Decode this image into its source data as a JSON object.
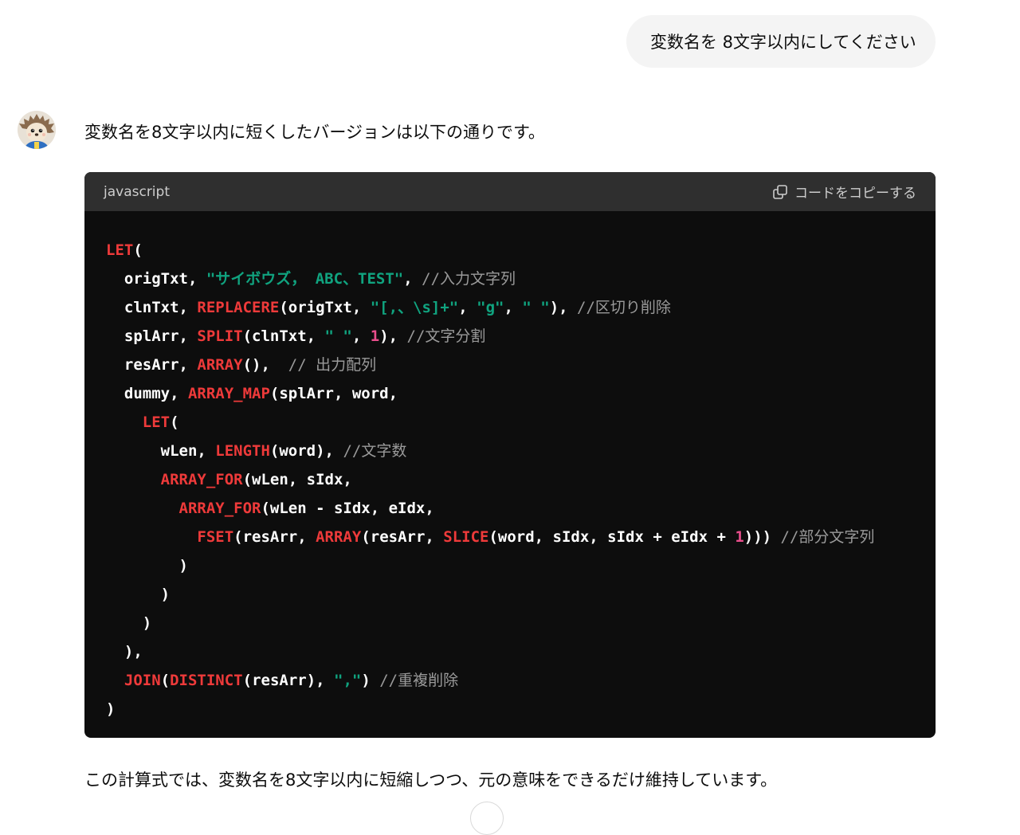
{
  "user_message": "変数名を 8文字以内にしてください",
  "assistant": {
    "avatar_icon": "hedgehog-avatar",
    "intro": "変数名を8文字以内に短くしたバージョンは以下の通りです。",
    "outro": "この計算式では、変数名を8文字以内に短縮しつつ、元の意味をできるだけ維持しています。"
  },
  "code_block": {
    "language": "javascript",
    "copy_label": "コードをコピーする",
    "copy_icon": "copy-icon",
    "token_colors": {
      "function": "#ee3a3a",
      "string": "#10a37f",
      "number": "#e94e8c",
      "comment": "#9a9a9a",
      "text": "#ffffff"
    },
    "lines": [
      [
        [
          "fn",
          "LET"
        ],
        [
          "t",
          "("
        ]
      ],
      [
        [
          "t",
          "  origTxt, "
        ],
        [
          "str",
          "\"サイボウズ， ABC、TEST\""
        ],
        [
          "t",
          ", "
        ],
        [
          "cmt",
          "//入力文字列"
        ]
      ],
      [
        [
          "t",
          "  clnTxt, "
        ],
        [
          "fn",
          "REPLACERE"
        ],
        [
          "t",
          "(origTxt, "
        ],
        [
          "str",
          "\"[,、\\s]+\""
        ],
        [
          "t",
          ", "
        ],
        [
          "str",
          "\"g\""
        ],
        [
          "t",
          ", "
        ],
        [
          "str",
          "\" \""
        ],
        [
          "t",
          "), "
        ],
        [
          "cmt",
          "//区切り削除"
        ]
      ],
      [
        [
          "t",
          "  splArr, "
        ],
        [
          "fn",
          "SPLIT"
        ],
        [
          "t",
          "(clnTxt, "
        ],
        [
          "str",
          "\" \""
        ],
        [
          "t",
          ", "
        ],
        [
          "num",
          "1"
        ],
        [
          "t",
          "), "
        ],
        [
          "cmt",
          "//文字分割"
        ]
      ],
      [
        [
          "t",
          "  resArr, "
        ],
        [
          "fn",
          "ARRAY"
        ],
        [
          "t",
          "(),  "
        ],
        [
          "cmt",
          "// 出力配列"
        ]
      ],
      [
        [
          "t",
          "  dummy, "
        ],
        [
          "fn",
          "ARRAY_MAP"
        ],
        [
          "t",
          "(splArr, word,"
        ]
      ],
      [
        [
          "t",
          "    "
        ],
        [
          "fn",
          "LET"
        ],
        [
          "t",
          "("
        ]
      ],
      [
        [
          "t",
          "      wLen, "
        ],
        [
          "fn",
          "LENGTH"
        ],
        [
          "t",
          "(word), "
        ],
        [
          "cmt",
          "//文字数"
        ]
      ],
      [
        [
          "t",
          "      "
        ],
        [
          "fn",
          "ARRAY_FOR"
        ],
        [
          "t",
          "(wLen, sIdx,"
        ]
      ],
      [
        [
          "t",
          "        "
        ],
        [
          "fn",
          "ARRAY_FOR"
        ],
        [
          "t",
          "(wLen - sIdx, eIdx,"
        ]
      ],
      [
        [
          "t",
          "          "
        ],
        [
          "fn",
          "FSET"
        ],
        [
          "t",
          "(resArr, "
        ],
        [
          "fn",
          "ARRAY"
        ],
        [
          "t",
          "(resArr, "
        ],
        [
          "fn",
          "SLICE"
        ],
        [
          "t",
          "(word, sIdx, sIdx + eIdx + "
        ],
        [
          "num",
          "1"
        ],
        [
          "t",
          "))) "
        ],
        [
          "cmt",
          "//部分文字列"
        ]
      ],
      [
        [
          "t",
          "        )"
        ]
      ],
      [
        [
          "t",
          "      )"
        ]
      ],
      [
        [
          "t",
          "    )"
        ]
      ],
      [
        [
          "t",
          "  ),"
        ]
      ],
      [
        [
          "t",
          "  "
        ],
        [
          "fn",
          "JOIN"
        ],
        [
          "t",
          "("
        ],
        [
          "fn",
          "DISTINCT"
        ],
        [
          "t",
          "(resArr), "
        ],
        [
          "str",
          "\",\""
        ],
        [
          "t",
          ") "
        ],
        [
          "cmt",
          "//重複削除"
        ]
      ],
      [
        [
          "t",
          ")"
        ]
      ]
    ]
  }
}
